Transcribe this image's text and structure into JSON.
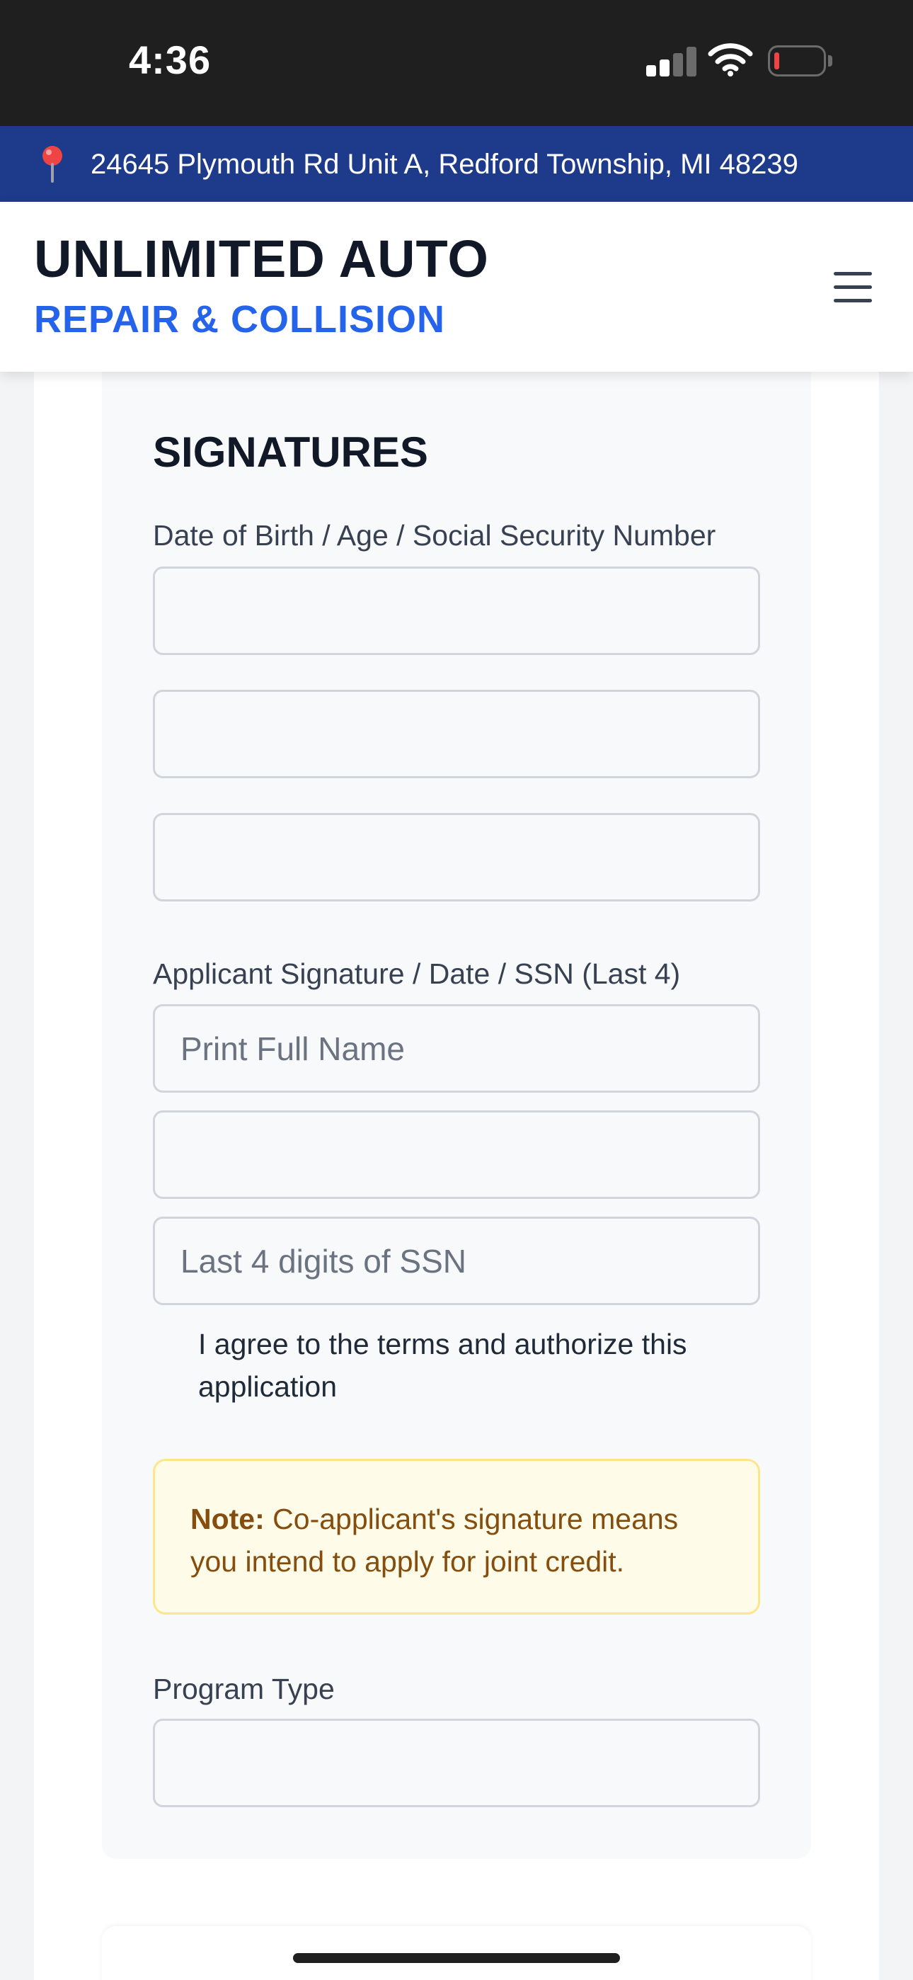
{
  "status_bar": {
    "time": "4:36",
    "icons": [
      "signal-icon",
      "wifi-icon",
      "battery-icon"
    ],
    "battery_color": "#ef4444"
  },
  "address_bar": {
    "icon": "map-pin-icon",
    "address": "24645 Plymouth Rd Unit A, Redford Township, MI 48239"
  },
  "header": {
    "brand_line1": "UNLIMITED AUTO",
    "brand_line2": "REPAIR & COLLISION",
    "menu_icon": "hamburger-menu-icon",
    "brand_color": "#2563eb"
  },
  "form": {
    "section_title": "SIGNATURES",
    "dob_group": {
      "label": "Date of Birth / Age / Social Security Number",
      "fields": [
        {
          "value": "",
          "placeholder": ""
        },
        {
          "value": "",
          "placeholder": ""
        },
        {
          "value": "",
          "placeholder": ""
        }
      ]
    },
    "applicant_group": {
      "label": "Applicant Signature / Date / SSN (Last 4)",
      "full_name_placeholder": "Print Full Name",
      "date_placeholder": "",
      "ssn_placeholder": "Last 4 digits of SSN"
    },
    "agree_checkbox": {
      "label": "I agree to the terms and authorize this application",
      "checked": false
    },
    "note": {
      "prefix": "Note:",
      "text": " Co-applicant's signature means you intend to apply for joint credit."
    },
    "program_type": {
      "label": "Program Type",
      "value": ""
    }
  }
}
